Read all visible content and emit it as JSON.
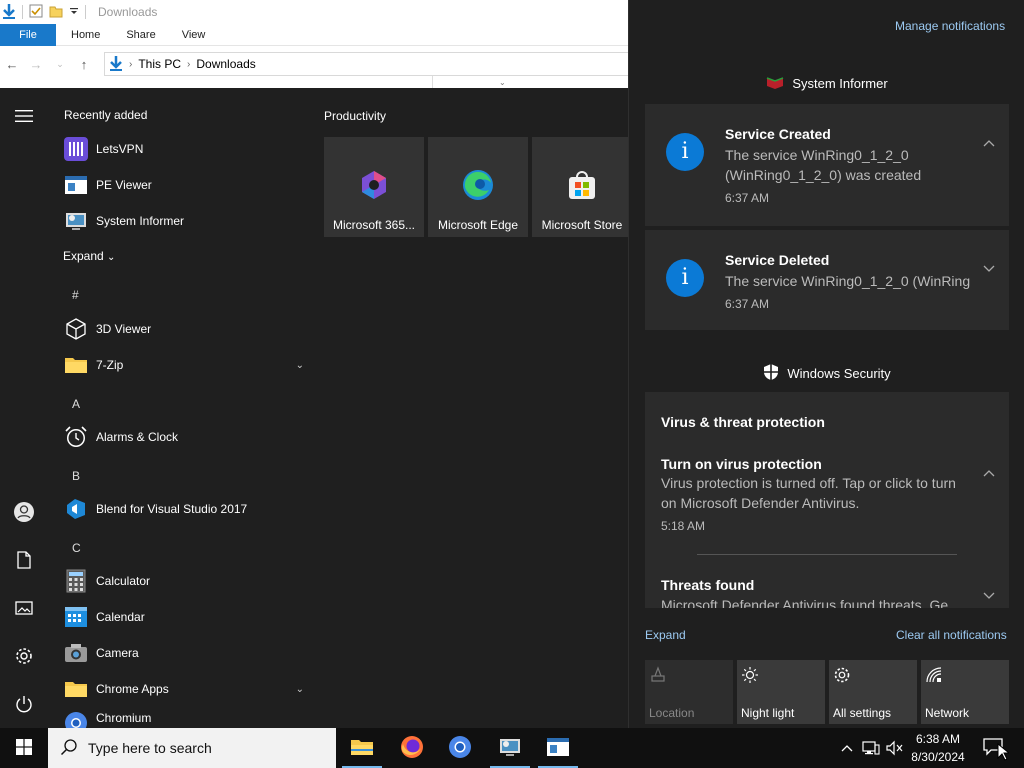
{
  "explorer": {
    "title": "Downloads",
    "tabs": {
      "file": "File",
      "home": "Home",
      "share": "Share",
      "view": "View"
    },
    "breadcrumb": [
      "This PC",
      "Downloads"
    ]
  },
  "start": {
    "recently_added_header": "Recently added",
    "recent_apps": [
      "LetsVPN",
      "PE Viewer",
      "System Informer"
    ],
    "expand_label": "Expand",
    "letters": {
      "hash": "#",
      "a": "A",
      "b": "B",
      "c": "C"
    },
    "apps": {
      "3d_viewer": "3D Viewer",
      "7zip": "7-Zip",
      "alarms": "Alarms & Clock",
      "blend": "Blend for Visual Studio 2017",
      "calculator": "Calculator",
      "calendar": "Calendar",
      "camera": "Camera",
      "chrome_apps": "Chrome Apps",
      "chromium": "Chromium"
    },
    "tiles_header": "Productivity",
    "tiles": [
      "Microsoft 365...",
      "Microsoft Edge",
      "Microsoft Store"
    ]
  },
  "action_center": {
    "manage": "Manage notifications",
    "sysinfo_source": "System Informer",
    "notifications": [
      {
        "title": "Service Created",
        "body": "The service WinRing0_1_2_0 (WinRing0_1_2_0) was created",
        "time": "6:37 AM"
      },
      {
        "title": "Service Deleted",
        "body": "The service WinRing0_1_2_0 (WinRing",
        "time": "6:37 AM"
      }
    ],
    "security_source": "Windows Security",
    "security_group": "Virus & threat protection",
    "security_items": [
      {
        "title": "Turn on virus protection",
        "body": "Virus protection is turned off. Tap or click to turn on Microsoft Defender Antivirus.",
        "time": "5:18 AM"
      },
      {
        "title": "Threats found",
        "body": "Microsoft Defender Antivirus found threats. Ge"
      }
    ],
    "expand": "Expand",
    "clear_all": "Clear all notifications",
    "quick_actions": [
      "Location",
      "Night light",
      "All settings",
      "Network"
    ]
  },
  "taskbar": {
    "search_placeholder": "Type here to search",
    "time": "6:38 AM",
    "date": "8/30/2024"
  },
  "colors": {
    "accent": "#0078d7",
    "link": "#9ccaf2",
    "info_icon": "#0b7ad6"
  }
}
